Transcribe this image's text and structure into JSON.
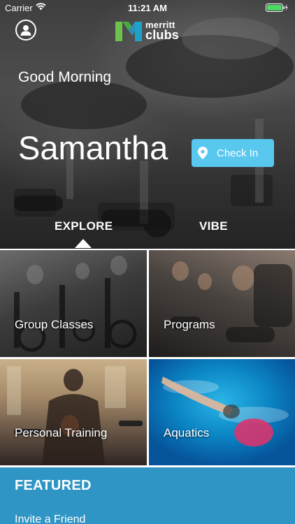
{
  "status_bar": {
    "carrier": "Carrier",
    "time": "11:21 AM",
    "wifi_icon": "wifi-icon",
    "battery_icon": "battery-charging-icon"
  },
  "header": {
    "profile_icon": "user-profile-icon",
    "logo_text_line1": "merritt",
    "logo_text_line2": "clubs"
  },
  "hero": {
    "greeting": "Good Morning",
    "name": "Samantha",
    "check_in_label": "Check In",
    "check_in_icon": "location-pin-icon"
  },
  "tabs": [
    {
      "label": "EXPLORE",
      "selected": true
    },
    {
      "label": "VIBE",
      "selected": false
    }
  ],
  "tiles": [
    {
      "label": "Group Classes"
    },
    {
      "label": "Programs"
    },
    {
      "label": "Personal Training"
    },
    {
      "label": "Aquatics"
    }
  ],
  "featured": {
    "title": "FEATURED",
    "items": [
      "Invite a Friend"
    ]
  },
  "colors": {
    "accent_blue": "#58c8ef",
    "featured_bg": "#2e95c5",
    "logo_green": "#6cc24a",
    "logo_teal": "#1fa1c9",
    "battery_green": "#4cd964"
  }
}
